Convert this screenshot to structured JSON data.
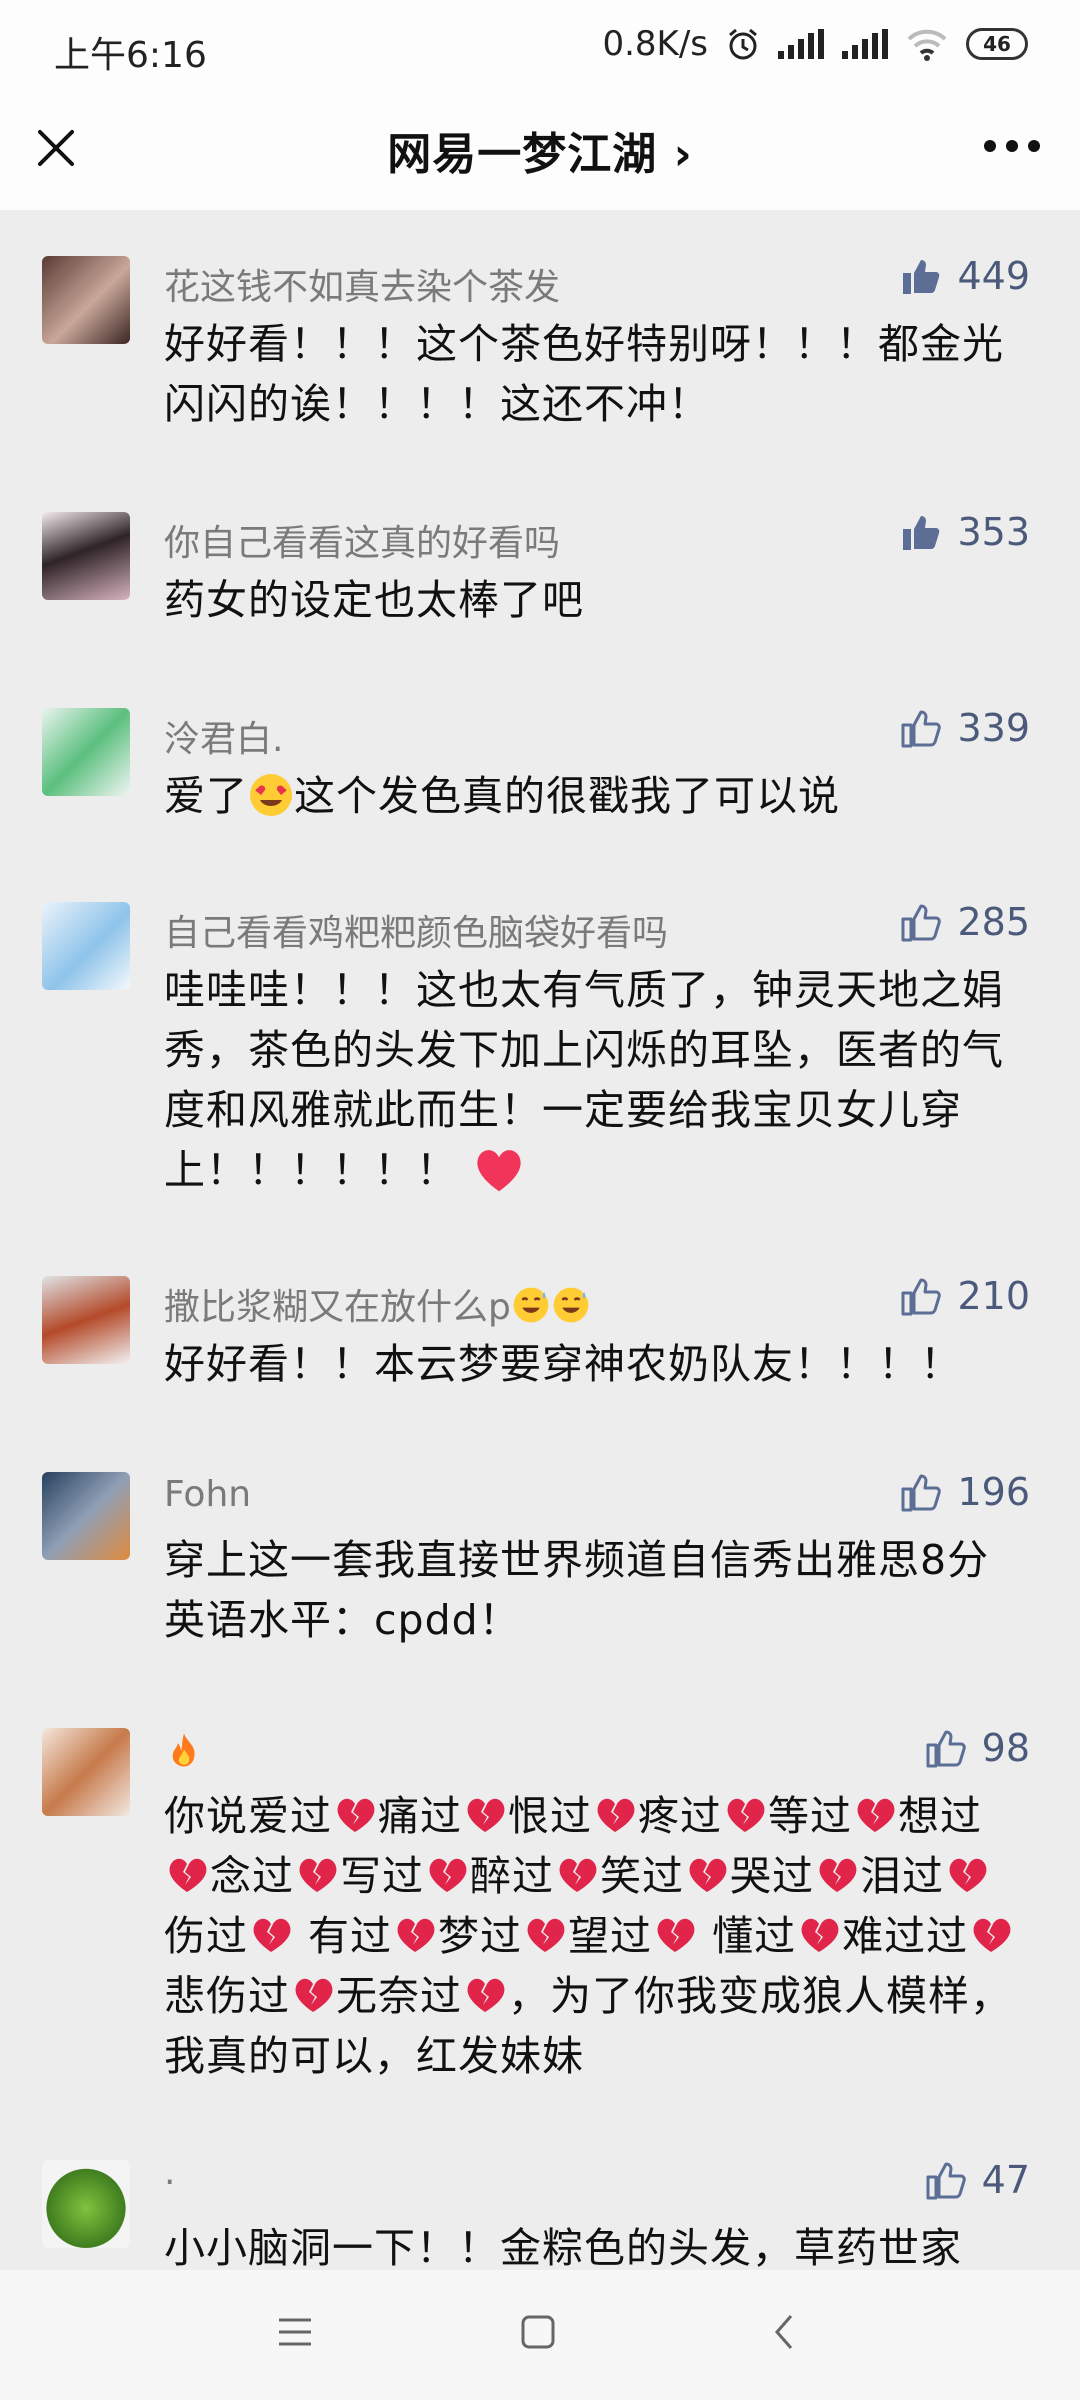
{
  "status": {
    "time": "上午6:16",
    "speed": "0.8K/s",
    "battery": "46"
  },
  "header": {
    "title": "网易一梦江湖 ›"
  },
  "comments": [
    {
      "name": "花这钱不如真去染个茶发",
      "likes": "449",
      "liked": true,
      "text": "好好看！！！这个茶色好特别呀！！！都金光闪闪的诶！！！！这还不冲！"
    },
    {
      "name": "你自己看看这真的好看吗",
      "likes": "353",
      "liked": true,
      "text": "药女的设定也太棒了吧"
    },
    {
      "name": "泠君白.",
      "likes": "339",
      "liked": false,
      "text_before": "爱了",
      "emoji": "heart-eyes-emoji",
      "text_after": "这个发色真的很戳我了可以说"
    },
    {
      "name": "自己看看鸡粑粑颜色脑袋好看吗",
      "likes": "285",
      "liked": false,
      "text": "哇哇哇！！！这也太有气质了，钟灵天地之娟秀，茶色的头发下加上闪烁的耳坠，医者的气度和风雅就此而生！一定要给我宝贝女儿穿上！！！！！！",
      "emoji": "red-heart-emoji"
    },
    {
      "name": "撒比浆糊又在放什么p",
      "name_emoji": "sweat-smile-emoji",
      "likes": "210",
      "liked": false,
      "text": "好好看！！本云梦要穿神农奶队友！！！！"
    },
    {
      "name": "Fohn",
      "likes": "196",
      "liked": false,
      "text": "穿上这一套我直接世界频道自信秀出雅思8分英语水平：cpdd！"
    },
    {
      "name_emoji": "fire-emoji",
      "likes": "98",
      "liked": false,
      "segments": [
        "你说爱过",
        "痛过",
        "恨过",
        "疼过",
        "等过",
        "想过",
        "念过",
        "写过",
        "醉过",
        "笑过",
        "哭过",
        "泪过",
        "伤过",
        " 有过",
        "梦过",
        "望过",
        " 懂过",
        "难过过",
        "悲伤过",
        "无奈过"
      ],
      "text_end": "，为了你我变成狼人模样，我真的可以，红发妹妹"
    },
    {
      "name": "·",
      "likes": "47",
      "liked": false,
      "text": "小小脑洞一下！！金粽色的头发，草药世家"
    }
  ]
}
